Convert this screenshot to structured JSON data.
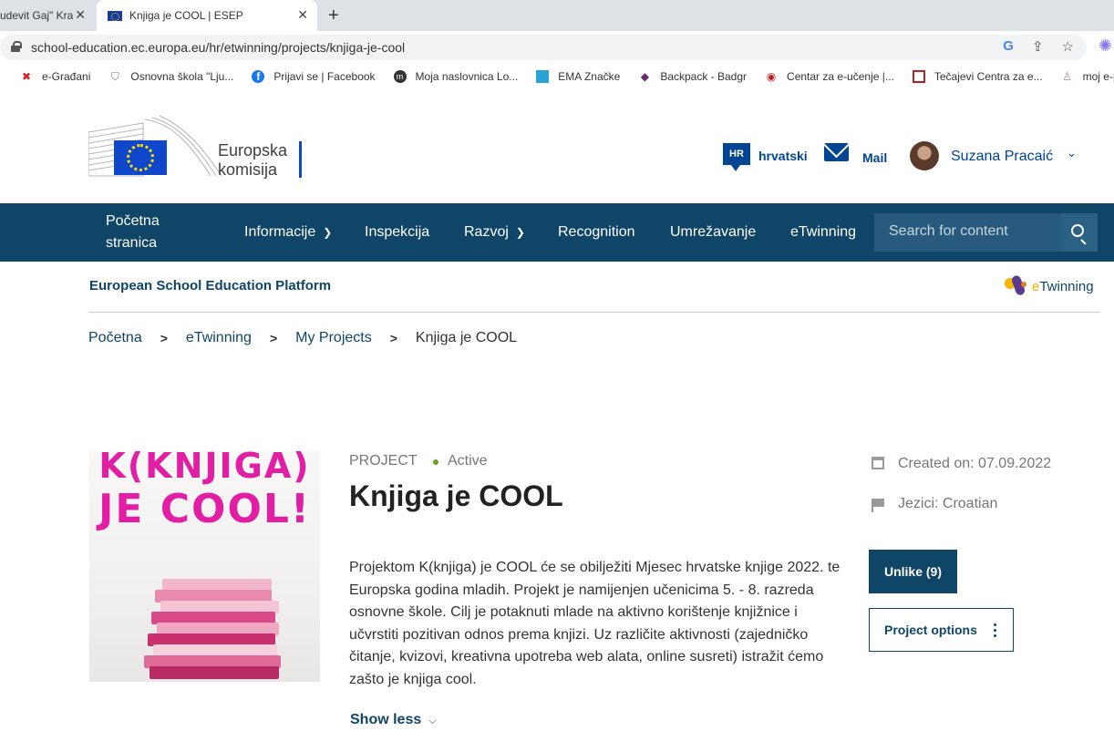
{
  "browser": {
    "tabs": [
      {
        "label": "udevit Gaj\" Krap",
        "close": "✕"
      },
      {
        "label": "Knjiga je COOL | ESEP",
        "close": "✕"
      }
    ],
    "new_tab": "+",
    "url": "school-education.ec.europa.eu/hr/etwinning/projects/knjiga-je-cool",
    "bookmarks": [
      {
        "icon": "croatian-coat-icon",
        "label": "e-Građani"
      },
      {
        "icon": "shield-icon",
        "label": "Osnovna škola \"Lju..."
      },
      {
        "icon": "facebook-icon",
        "label": "Prijavi se | Facebook"
      },
      {
        "icon": "moodle-icon",
        "label": "Moja naslovnica Lo..."
      },
      {
        "icon": "ema-icon",
        "label": "EMA Značke"
      },
      {
        "icon": "backpack-icon",
        "label": "Backpack - Badgr"
      },
      {
        "icon": "carnet-icon",
        "label": "Centar za e-učenje |..."
      },
      {
        "icon": "carnet-courses-icon",
        "label": "Tečajevi Centra za e..."
      },
      {
        "icon": "portfolio-icon",
        "label": "moj e-portfolio"
      }
    ]
  },
  "header": {
    "logo_text_line1": "Europska",
    "logo_text_line2": "komisija",
    "language_code": "HR",
    "language_label": "hrvatski",
    "mail_label": "Mail",
    "user_name": "Suzana Pracaić"
  },
  "nav": {
    "home_line1": "Početna",
    "home_line2": "stranica",
    "items": [
      {
        "label": "Informacije",
        "has_dropdown": true
      },
      {
        "label": "Inspekcija",
        "has_dropdown": false
      },
      {
        "label": "Razvoj",
        "has_dropdown": true
      },
      {
        "label": "Recognition",
        "has_dropdown": false
      },
      {
        "label": "Umrežavanje",
        "has_dropdown": false
      },
      {
        "label": "eTwinning",
        "has_dropdown": false
      }
    ],
    "search_placeholder": "Search for content"
  },
  "platform": {
    "title": "European School Education Platform",
    "etwinning_logo_e": "e",
    "etwinning_logo_rest": "Twinning"
  },
  "breadcrumb": [
    "Početna",
    "eTwinning",
    "My Projects",
    "Knjiga je COOL"
  ],
  "project": {
    "cover_line1": "K(KNJIGA)",
    "cover_line2": "JE COOL!",
    "type": "PROJECT",
    "status": "Active",
    "title": "Knjiga je COOL",
    "description": "Projektom K(knjiga) je COOL će se obilježiti Mjesec hrvatske knjige 2022. te Europska godina mladih. Projekt je namijenjen učenicima 5. - 8. razreda osnovne škole. Cilj je potaknuti mlade na aktivno korištenje knjižnice i učvrstiti pozitivan odnos prema knjizi. Uz različite aktivnosti (zajedničko čitanje, kvizovi, kreativna upotreba web alata, online susreti) istražit ćemo zašto je knjiga cool.",
    "show_less": "Show less",
    "created_on": "Created on: 07.09.2022",
    "languages": "Jezici: Croatian",
    "unlike_label": "Unlike (9)",
    "options_label": "Project options"
  },
  "colors": {
    "nav_bg": "#0f4567",
    "ec_blue": "#004494",
    "cover_pink": "#e21fa4",
    "status_green": "#6aa31d"
  }
}
